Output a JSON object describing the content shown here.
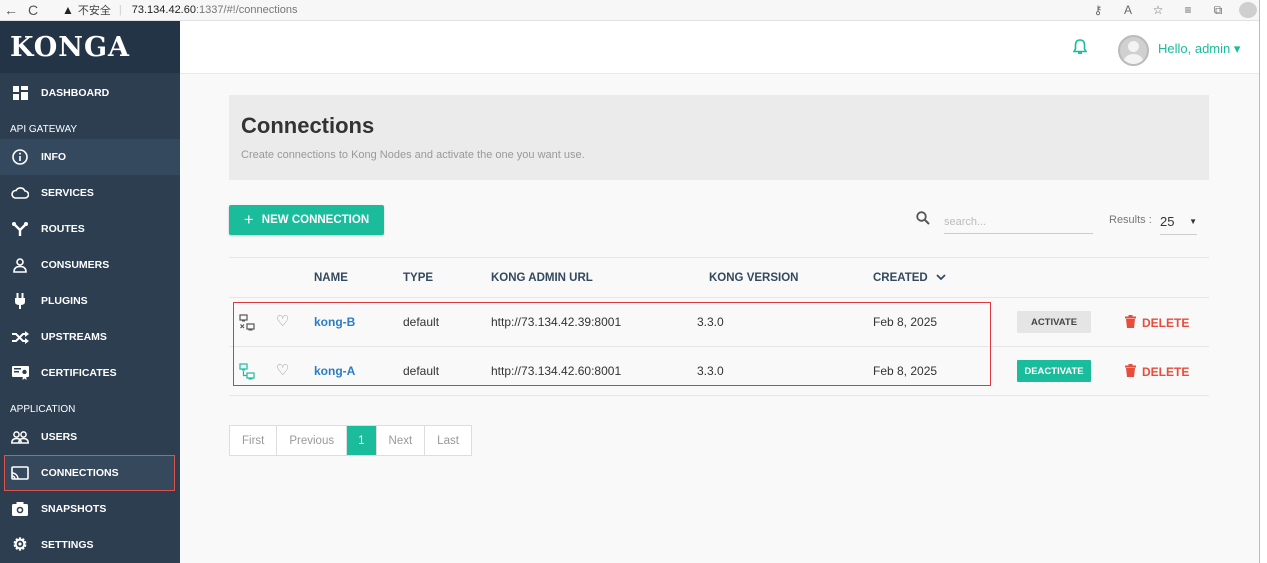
{
  "browser": {
    "back": "←",
    "reload": "C",
    "warning": "▲",
    "insecure_label": "不安全",
    "separator": "|",
    "url_host": "73.134.42.60",
    "url_path": ":1337/#!/connections"
  },
  "sidebar": {
    "logo": "KONGA",
    "items": [
      {
        "label": "DASHBOARD",
        "icon": "dashboard-icon"
      },
      {
        "label": "INFO",
        "icon": "info-icon"
      },
      {
        "label": "SERVICES",
        "icon": "cloud-icon"
      },
      {
        "label": "ROUTES",
        "icon": "routes-icon"
      },
      {
        "label": "CONSUMERS",
        "icon": "user-icon"
      },
      {
        "label": "PLUGINS",
        "icon": "plug-icon"
      },
      {
        "label": "UPSTREAMS",
        "icon": "shuffle-icon"
      },
      {
        "label": "CERTIFICATES",
        "icon": "certificate-icon"
      },
      {
        "label": "USERS",
        "icon": "users-icon"
      },
      {
        "label": "CONNECTIONS",
        "icon": "cast-icon"
      },
      {
        "label": "SNAPSHOTS",
        "icon": "camera-icon"
      },
      {
        "label": "SETTINGS",
        "icon": "gear-icon"
      }
    ],
    "sections": {
      "api_gateway": "API GATEWAY",
      "application": "APPLICATION"
    }
  },
  "header": {
    "greeting": "Hello, admin ▾"
  },
  "page": {
    "title": "Connections",
    "subtitle": "Create connections to Kong Nodes and activate the one you want use."
  },
  "toolbar": {
    "new_connection": "NEW CONNECTION",
    "search_placeholder": "search...",
    "results_label": "Results :",
    "results_value": "25"
  },
  "table": {
    "headers": {
      "name": "NAME",
      "type": "TYPE",
      "url": "KONG ADMIN URL",
      "version": "KONG VERSION",
      "created": "CREATED"
    },
    "rows": [
      {
        "name": "kong-B",
        "type": "default",
        "url": "http://73.134.42.39:8001",
        "version": "3.3.0",
        "created": "Feb 8, 2025",
        "action": "ACTIVATE",
        "delete": "DELETE",
        "active": false
      },
      {
        "name": "kong-A",
        "type": "default",
        "url": "http://73.134.42.60:8001",
        "version": "3.3.0",
        "created": "Feb 8, 2025",
        "action": "DEACTIVATE",
        "delete": "DELETE",
        "active": true
      }
    ]
  },
  "pagination": {
    "first": "First",
    "previous": "Previous",
    "current": "1",
    "next": "Next",
    "last": "Last"
  },
  "colors": {
    "accent": "#1abc9c",
    "sidebar": "#2c3e50",
    "danger": "#e74c3c",
    "link": "#2a7cc7"
  }
}
